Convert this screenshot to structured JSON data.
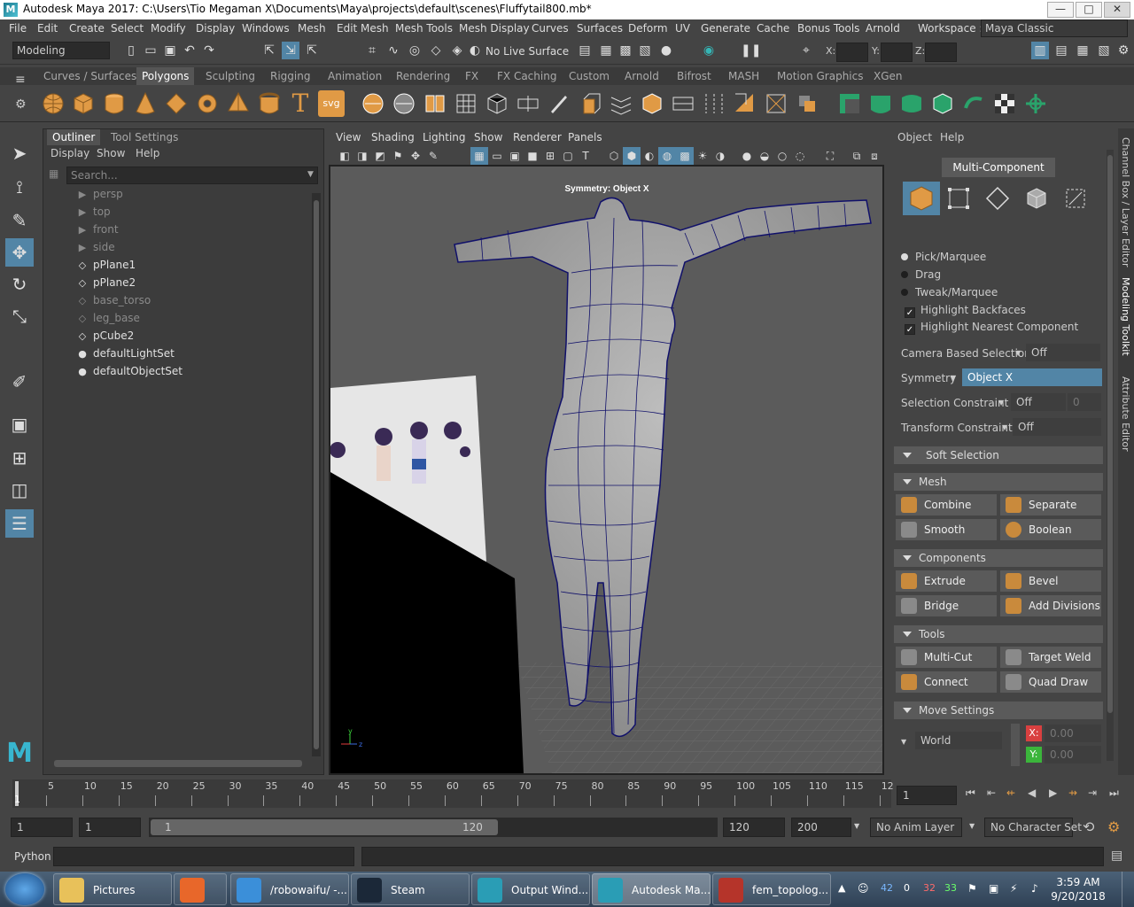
{
  "window": {
    "title": "Autodesk Maya 2017: C:\\Users\\Tio Megaman X\\Documents\\Maya\\projects\\default\\scenes\\Fluffytail800.mb*",
    "logo_letter": "M",
    "minimize": "—",
    "maximize": "□",
    "close": "✕"
  },
  "menubar": {
    "items": [
      "File",
      "Edit",
      "Create",
      "Select",
      "Modify",
      "Display",
      "Windows",
      "Mesh",
      "Edit Mesh",
      "Mesh Tools",
      "Mesh Display",
      "Curves",
      "Surfaces",
      "Deform",
      "UV",
      "Generate",
      "Cache",
      "Bonus Tools",
      "Arnold"
    ],
    "workspace_label": "Workspace :",
    "workspace_value": "Maya Classic"
  },
  "statusline": {
    "mode": "Modeling",
    "live_surface": "No Live Surface",
    "x_label": "X:",
    "y_label": "Y:",
    "z_label": "Z:"
  },
  "shelf": {
    "tabs": [
      "Curves / Surfaces",
      "Polygons",
      "Sculpting",
      "Rigging",
      "Animation",
      "Rendering",
      "FX",
      "FX Caching",
      "Custom",
      "Arnold",
      "Bifrost",
      "MASH",
      "Motion Graphics",
      "XGen"
    ],
    "active_tab": "Polygons",
    "text_icon": "T",
    "svg_icon": "svg"
  },
  "outliner": {
    "tabs": [
      "Outliner",
      "Tool Settings"
    ],
    "menu": [
      "Display",
      "Show",
      "Help"
    ],
    "search_placeholder": "Search...",
    "items": [
      {
        "label": "persp",
        "icon": "camera-icon",
        "dim": true
      },
      {
        "label": "top",
        "icon": "camera-icon",
        "dim": true
      },
      {
        "label": "front",
        "icon": "camera-icon",
        "dim": true
      },
      {
        "label": "side",
        "icon": "camera-icon",
        "dim": true
      },
      {
        "label": "pPlane1",
        "icon": "mesh-icon",
        "dim": false
      },
      {
        "label": "pPlane2",
        "icon": "mesh-icon",
        "dim": false
      },
      {
        "label": "base_torso",
        "icon": "mesh-icon",
        "dim": true
      },
      {
        "label": "leg_base",
        "icon": "mesh-icon",
        "dim": true
      },
      {
        "label": "pCube2",
        "icon": "mesh-icon",
        "dim": false
      },
      {
        "label": "defaultLightSet",
        "icon": "set-icon",
        "dim": false
      },
      {
        "label": "defaultObjectSet",
        "icon": "set-icon",
        "dim": false
      }
    ]
  },
  "viewport": {
    "menu": [
      "View",
      "Shading",
      "Lighting",
      "Show",
      "Renderer",
      "Panels"
    ],
    "hud_symmetry": "Symmetry: Object X",
    "axis_y": "y",
    "axis_z": "z"
  },
  "modeling_toolkit": {
    "menu": [
      "Object",
      "Help"
    ],
    "mode_button": "Multi-Component",
    "pick": "Pick/Marquee",
    "drag": "Drag",
    "tweak": "Tweak/Marquee",
    "highlight_backfaces": "Highlight Backfaces",
    "highlight_nearest": "Highlight Nearest Component",
    "camera_based_label": "Camera Based Selection",
    "camera_based_value": "Off",
    "symmetry_label": "Symmetry",
    "symmetry_value": "Object X",
    "selection_constraint_label": "Selection Constraint",
    "selection_constraint_value": "Off",
    "selection_constraint_num": "0",
    "transform_constraint_label": "Transform Constraint",
    "transform_constraint_value": "Off",
    "soft_selection": "Soft Selection",
    "mesh_section": "Mesh",
    "mesh_buttons": [
      "Combine",
      "Separate",
      "Smooth",
      "Boolean"
    ],
    "components_section": "Components",
    "components_buttons": [
      "Extrude",
      "Bevel",
      "Bridge",
      "Add Divisions"
    ],
    "tools_section": "Tools",
    "tools_buttons": [
      "Multi-Cut",
      "Target Weld",
      "Connect",
      "Quad Draw"
    ],
    "move_settings": "Move Settings",
    "world": "World",
    "x_label": "X:",
    "x_value": "0.00",
    "y_label": "Y:",
    "y_value": "0.00"
  },
  "side_tabs": [
    "Channel Box / Layer Editor",
    "Modeling Toolkit",
    "Attribute Editor"
  ],
  "timeline": {
    "ticks": [
      "5",
      "10",
      "15",
      "20",
      "25",
      "30",
      "35",
      "40",
      "45",
      "50",
      "55",
      "60",
      "65",
      "70",
      "75",
      "80",
      "85",
      "90",
      "95",
      "100",
      "105",
      "110",
      "115",
      "12"
    ],
    "current_frame_marker": "1",
    "current_frame": "1"
  },
  "range": {
    "start": "1",
    "playback_start": "1",
    "slider_start": "1",
    "slider_end": "120",
    "playback_end": "120",
    "end": "200",
    "anim_layer": "No Anim Layer",
    "character_set": "No Character Set"
  },
  "cmdline": {
    "label": "Python"
  },
  "taskbar": {
    "apps": [
      {
        "label": "Pictures",
        "color": "#e8c15a"
      },
      {
        "label": "",
        "color": "#e8672a"
      },
      {
        "label": "/robowaifu/ -...",
        "color": "#3b8fd9"
      },
      {
        "label": "Steam",
        "color": "#1b2838"
      },
      {
        "label": "Output Wind...",
        "color": "#2a9db5"
      },
      {
        "label": "Autodesk Ma...",
        "color": "#2a9db5"
      },
      {
        "label": "fem_topolog...",
        "color": "#b5342a"
      }
    ],
    "tray_nums": [
      "42",
      "0",
      "32",
      "33"
    ],
    "time": "3:59 AM",
    "date": "9/20/2018"
  }
}
